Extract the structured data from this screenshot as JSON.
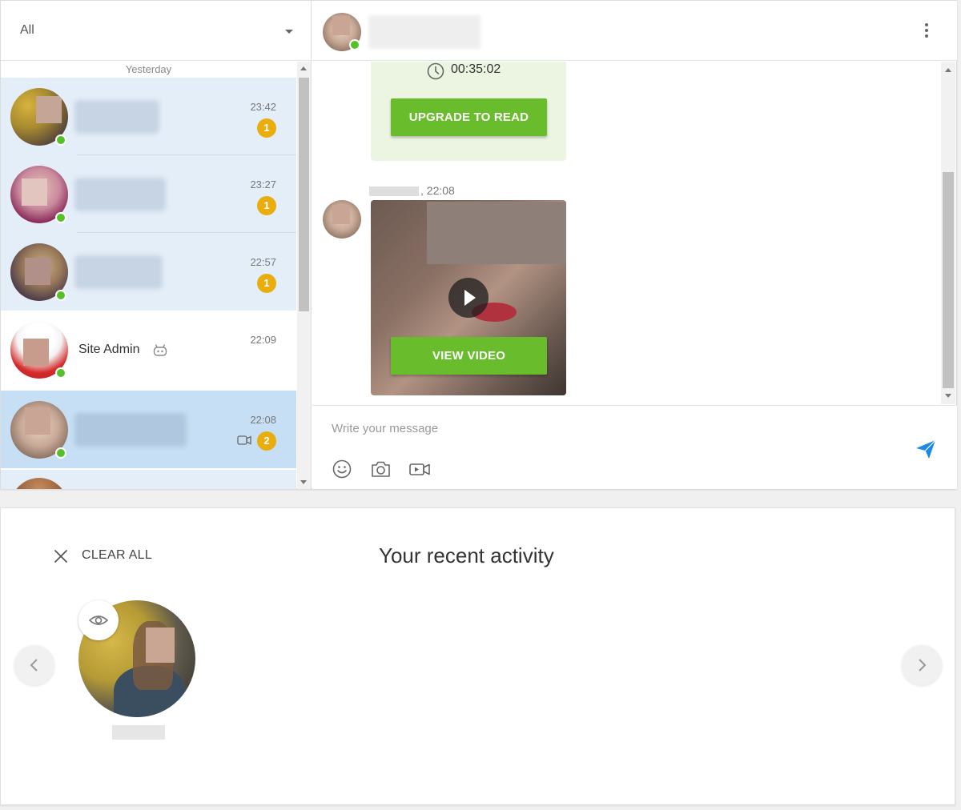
{
  "filter": {
    "selected": "All"
  },
  "conversations": {
    "day_label": "Yesterday",
    "items": [
      {
        "time": "23:42",
        "unread": "1",
        "state": "unread"
      },
      {
        "time": "23:27",
        "unread": "1",
        "state": "unread"
      },
      {
        "time": "22:57",
        "unread": "1",
        "state": "unread"
      },
      {
        "name": "Site Admin",
        "time": "22:09",
        "state": "read",
        "icon": "robot-icon"
      },
      {
        "time": "22:08",
        "unread": "2",
        "state": "selected",
        "icon": "video-icon"
      }
    ]
  },
  "chat": {
    "locked": {
      "timer": "00:35:02",
      "button": "UPGRADE TO READ"
    },
    "video_message": {
      "time": "22:08",
      "button": "VIEW VIDEO"
    },
    "composer": {
      "placeholder": "Write your message"
    }
  },
  "activity": {
    "clear_label": "CLEAR ALL",
    "title": "Your recent activity"
  },
  "colors": {
    "accent_green": "#69bd2d",
    "online_green": "#56c02a",
    "badge_yellow": "#e9ad0e",
    "send_blue": "#1e88e5",
    "unread_bg": "#e4eef9",
    "selected_bg": "#c6dff4"
  }
}
